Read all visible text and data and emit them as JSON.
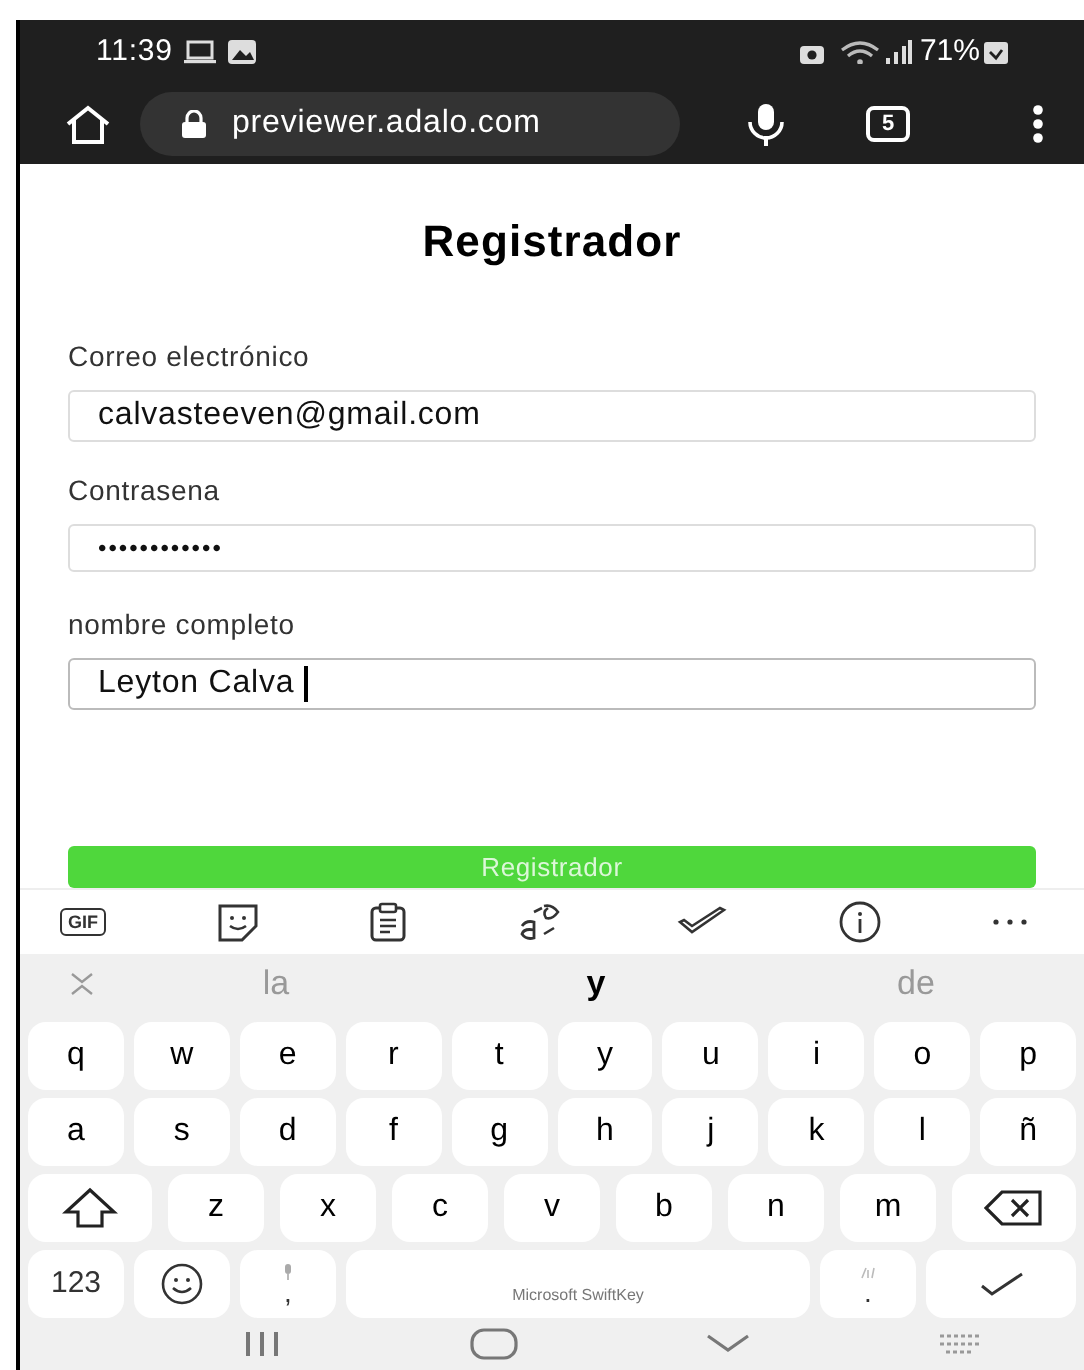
{
  "status_bar": {
    "time": "11:39",
    "battery": "71%"
  },
  "browser": {
    "url": "previewer.adalo.com",
    "tab_count": "5"
  },
  "form": {
    "title": "Registrador",
    "fields": [
      {
        "label": "Correo electrónico",
        "value": "calvasteeven@gmail.com",
        "kind": "text",
        "focused": false
      },
      {
        "label": "Contrasena",
        "value": "••••••••••••",
        "kind": "password",
        "focused": false
      },
      {
        "label": "nombre completo",
        "value": "Leyton Calva",
        "kind": "text",
        "focused": true
      }
    ],
    "submit": "Registrador"
  },
  "keyboard": {
    "toolbar": {
      "gif": "GIF"
    },
    "suggestions": [
      {
        "text": "la",
        "selected": false
      },
      {
        "text": "y",
        "selected": true
      },
      {
        "text": "de",
        "selected": false
      }
    ],
    "rows": [
      {
        "keys": [
          {
            "kind": "letter",
            "label": "q"
          },
          {
            "kind": "letter",
            "label": "w"
          },
          {
            "kind": "letter",
            "label": "e"
          },
          {
            "kind": "letter",
            "label": "r"
          },
          {
            "kind": "letter",
            "label": "t"
          },
          {
            "kind": "letter",
            "label": "y"
          },
          {
            "kind": "letter",
            "label": "u"
          },
          {
            "kind": "letter",
            "label": "i"
          },
          {
            "kind": "letter",
            "label": "o"
          },
          {
            "kind": "letter",
            "label": "p"
          }
        ]
      },
      {
        "keys": [
          {
            "kind": "letter",
            "label": "a"
          },
          {
            "kind": "letter",
            "label": "s"
          },
          {
            "kind": "letter",
            "label": "d"
          },
          {
            "kind": "letter",
            "label": "f"
          },
          {
            "kind": "letter",
            "label": "g"
          },
          {
            "kind": "letter",
            "label": "h"
          },
          {
            "kind": "letter",
            "label": "j"
          },
          {
            "kind": "letter",
            "label": "k"
          },
          {
            "kind": "letter",
            "label": "l"
          },
          {
            "kind": "letter",
            "label": "ñ"
          }
        ]
      },
      {
        "keys": [
          {
            "kind": "shift"
          },
          {
            "kind": "letter",
            "label": "z"
          },
          {
            "kind": "letter",
            "label": "x"
          },
          {
            "kind": "letter",
            "label": "c"
          },
          {
            "kind": "letter",
            "label": "v"
          },
          {
            "kind": "letter",
            "label": "b"
          },
          {
            "kind": "letter",
            "label": "n"
          },
          {
            "kind": "letter",
            "label": "m"
          },
          {
            "kind": "backspace"
          }
        ]
      },
      {
        "keys": [
          {
            "kind": "symbols",
            "label": "123"
          },
          {
            "kind": "emoji"
          },
          {
            "kind": "comma",
            "label": ","
          },
          {
            "kind": "space",
            "label": "Microsoft SwiftKey"
          },
          {
            "kind": "period",
            "label": "."
          },
          {
            "kind": "enter"
          }
        ]
      }
    ]
  }
}
